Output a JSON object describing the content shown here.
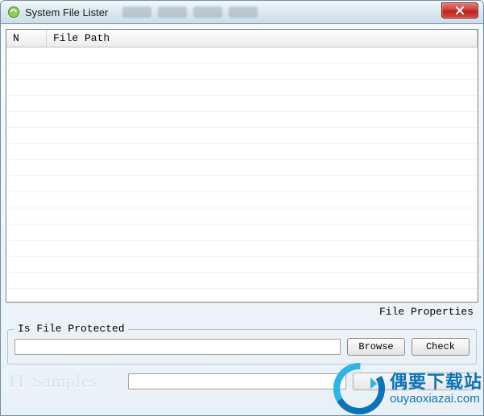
{
  "window": {
    "title": "System File Lister"
  },
  "list": {
    "col_n": "N",
    "col_path": "File Path"
  },
  "labels": {
    "file_properties": "File Properties",
    "groupbox_legend": "Is File Protected"
  },
  "buttons": {
    "browse": "Browse",
    "check": "Check"
  },
  "inputs": {
    "protected_path_value": "",
    "bottom_input_value": ""
  },
  "brand": {
    "text": "IT Samples"
  },
  "watermark": {
    "cn": "偶要下载站",
    "url": "ouyaoxiazai.com"
  }
}
